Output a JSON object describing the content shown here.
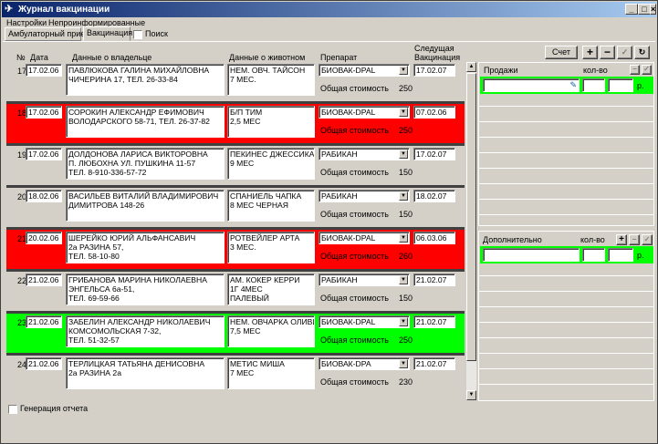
{
  "window": {
    "title": "Журнал вакцинации",
    "buttons": {
      "minimize": "_",
      "maximize": "□",
      "close": "×"
    }
  },
  "menu": [
    "Настройки",
    "Непроинформированные"
  ],
  "tabs": [
    "Амбулаторный прием",
    "Вакцинация"
  ],
  "search_label": "Поиск",
  "columns": {
    "num": "№",
    "date": "Дата",
    "owner": "Данные о владельце",
    "animal": "Данные о животном",
    "drug": "Препарат",
    "next1": "Следущая",
    "next2": "Вакцинация"
  },
  "schet_label": "Счет",
  "total_label": "Общая стоимость",
  "records": [
    {
      "num": "17",
      "date": "17.02.06",
      "owner1": "ПАВЛЮКОВА ГАЛИНА МИХАЙЛОВНА",
      "owner2": "ЧИЧЕРИНА 17, ТЕЛ. 26-33-84",
      "owner3": "",
      "animal1": "НЕМ. ОВЧ. ТАЙСОН",
      "animal2": "7 МЕС.",
      "animal3": "",
      "drug": "БИОВАК-DPAL",
      "next": "17.02.07",
      "total": "250",
      "color": "none"
    },
    {
      "num": "18",
      "date": "17.02.06",
      "owner1": "СОРОКИН АЛЕКСАНДР ЕФИМОВИЧ",
      "owner2": "ВОЛОДАРСКОГО 58-71, ТЕЛ. 26-37-82",
      "owner3": "",
      "animal1": "Б/П ТИМ",
      "animal2": "2,5 МЕС",
      "animal3": "",
      "drug": "БИОВАК-DPAL",
      "next": "07.02.06",
      "total": "250",
      "color": "red"
    },
    {
      "num": "19",
      "date": "17.02.06",
      "owner1": "ДОЛДОНОВА ЛАРИСА ВИКТОРОВНА",
      "owner2": "П. ЛЮБОХНА УЛ. ПУШКИНА 11-57",
      "owner3": "ТЕЛ. 8-910-336-57-72",
      "animal1": "ПЕКИНЕС ДЖЕССИКА",
      "animal2": "9 МЕС",
      "animal3": "",
      "drug": "РАБИКАН",
      "next": "17.02.07",
      "total": "150",
      "color": "none"
    },
    {
      "num": "20",
      "date": "18.02.06",
      "owner1": "ВАСИЛЬЕВ ВИТАЛИЙ ВЛАДИМИРОВИЧ",
      "owner2": "ДИМИТРОВА 148-26",
      "owner3": "",
      "animal1": "СПАНИЕЛЬ ЧАПКА",
      "animal2": "8 МЕС    ЧЕРНАЯ",
      "animal3": "",
      "drug": "РАБИКАН",
      "next": "18.02.07",
      "total": "150",
      "color": "none"
    },
    {
      "num": "21",
      "date": "20.02.06",
      "owner1": "ШЕРЕЙКО ЮРИЙ АЛЬФАНСАВИЧ",
      "owner2": "2а РАЗИНА 57,",
      "owner3": "ТЕЛ.  58-10-80",
      "animal1": "РОТВЕЙЛЕР АРТА",
      "animal2": "3 МЕС.",
      "animal3": "",
      "drug": "БИОВАК-DPAL",
      "next": "06.03.06",
      "total": "260",
      "color": "red"
    },
    {
      "num": "22",
      "date": "21.02.06",
      "owner1": "ГРИБАНОВА МАРИНА НИКОЛАЕВНА",
      "owner2": "ЭНГЕЛЬСА 6а-51,",
      "owner3": "ТЕЛ.  69-59-66",
      "animal1": "АМ. КОКЕР КЕРРИ",
      "animal2": "1Г 4МЕС",
      "animal3": "ПАЛЕВЫЙ",
      "drug": "РАБИКАН",
      "next": "21.02.07",
      "total": "150",
      "color": "none"
    },
    {
      "num": "23",
      "date": "21.02.06",
      "owner1": "ЗАБЕЛИН АЛЕКСАНДР НИКОЛАЕВИЧ",
      "owner2": "КОМСОМОЛЬСКАЯ  7-32,",
      "owner3": "ТЕЛ.  51-32-57",
      "animal1": "НЕМ. ОВЧАРКА ОЛИВИЯ",
      "animal2": "7,5 МЕС",
      "animal3": "",
      "drug": "БИОВАК-DPAL",
      "next": "21.02.07",
      "total": "250",
      "color": "green"
    },
    {
      "num": "24",
      "date": "21.02.06",
      "owner1": "ТЕРЛИЦКАЯ ТАТЬЯНА ДЕНИСОВНА",
      "owner2": "2а РАЗИНА  2а",
      "owner3": "",
      "animal1": "МЕТИС МИША",
      "animal2": "7 МЕС",
      "animal3": "",
      "drug": "БИОВАК-DPA",
      "next": "21.02.07",
      "total": "230",
      "color": "none"
    }
  ],
  "sales": {
    "title": "Продажи",
    "qty": "кол-во",
    "rub": "р."
  },
  "extra": {
    "title": "Дополнительно",
    "qty": "кол-во",
    "rub": "р."
  },
  "report_label": "Генерация отчета",
  "colors": {
    "red": "#ff0000",
    "green": "#00ff00",
    "title_start": "#0a246a",
    "title_end": "#a6caf0"
  }
}
